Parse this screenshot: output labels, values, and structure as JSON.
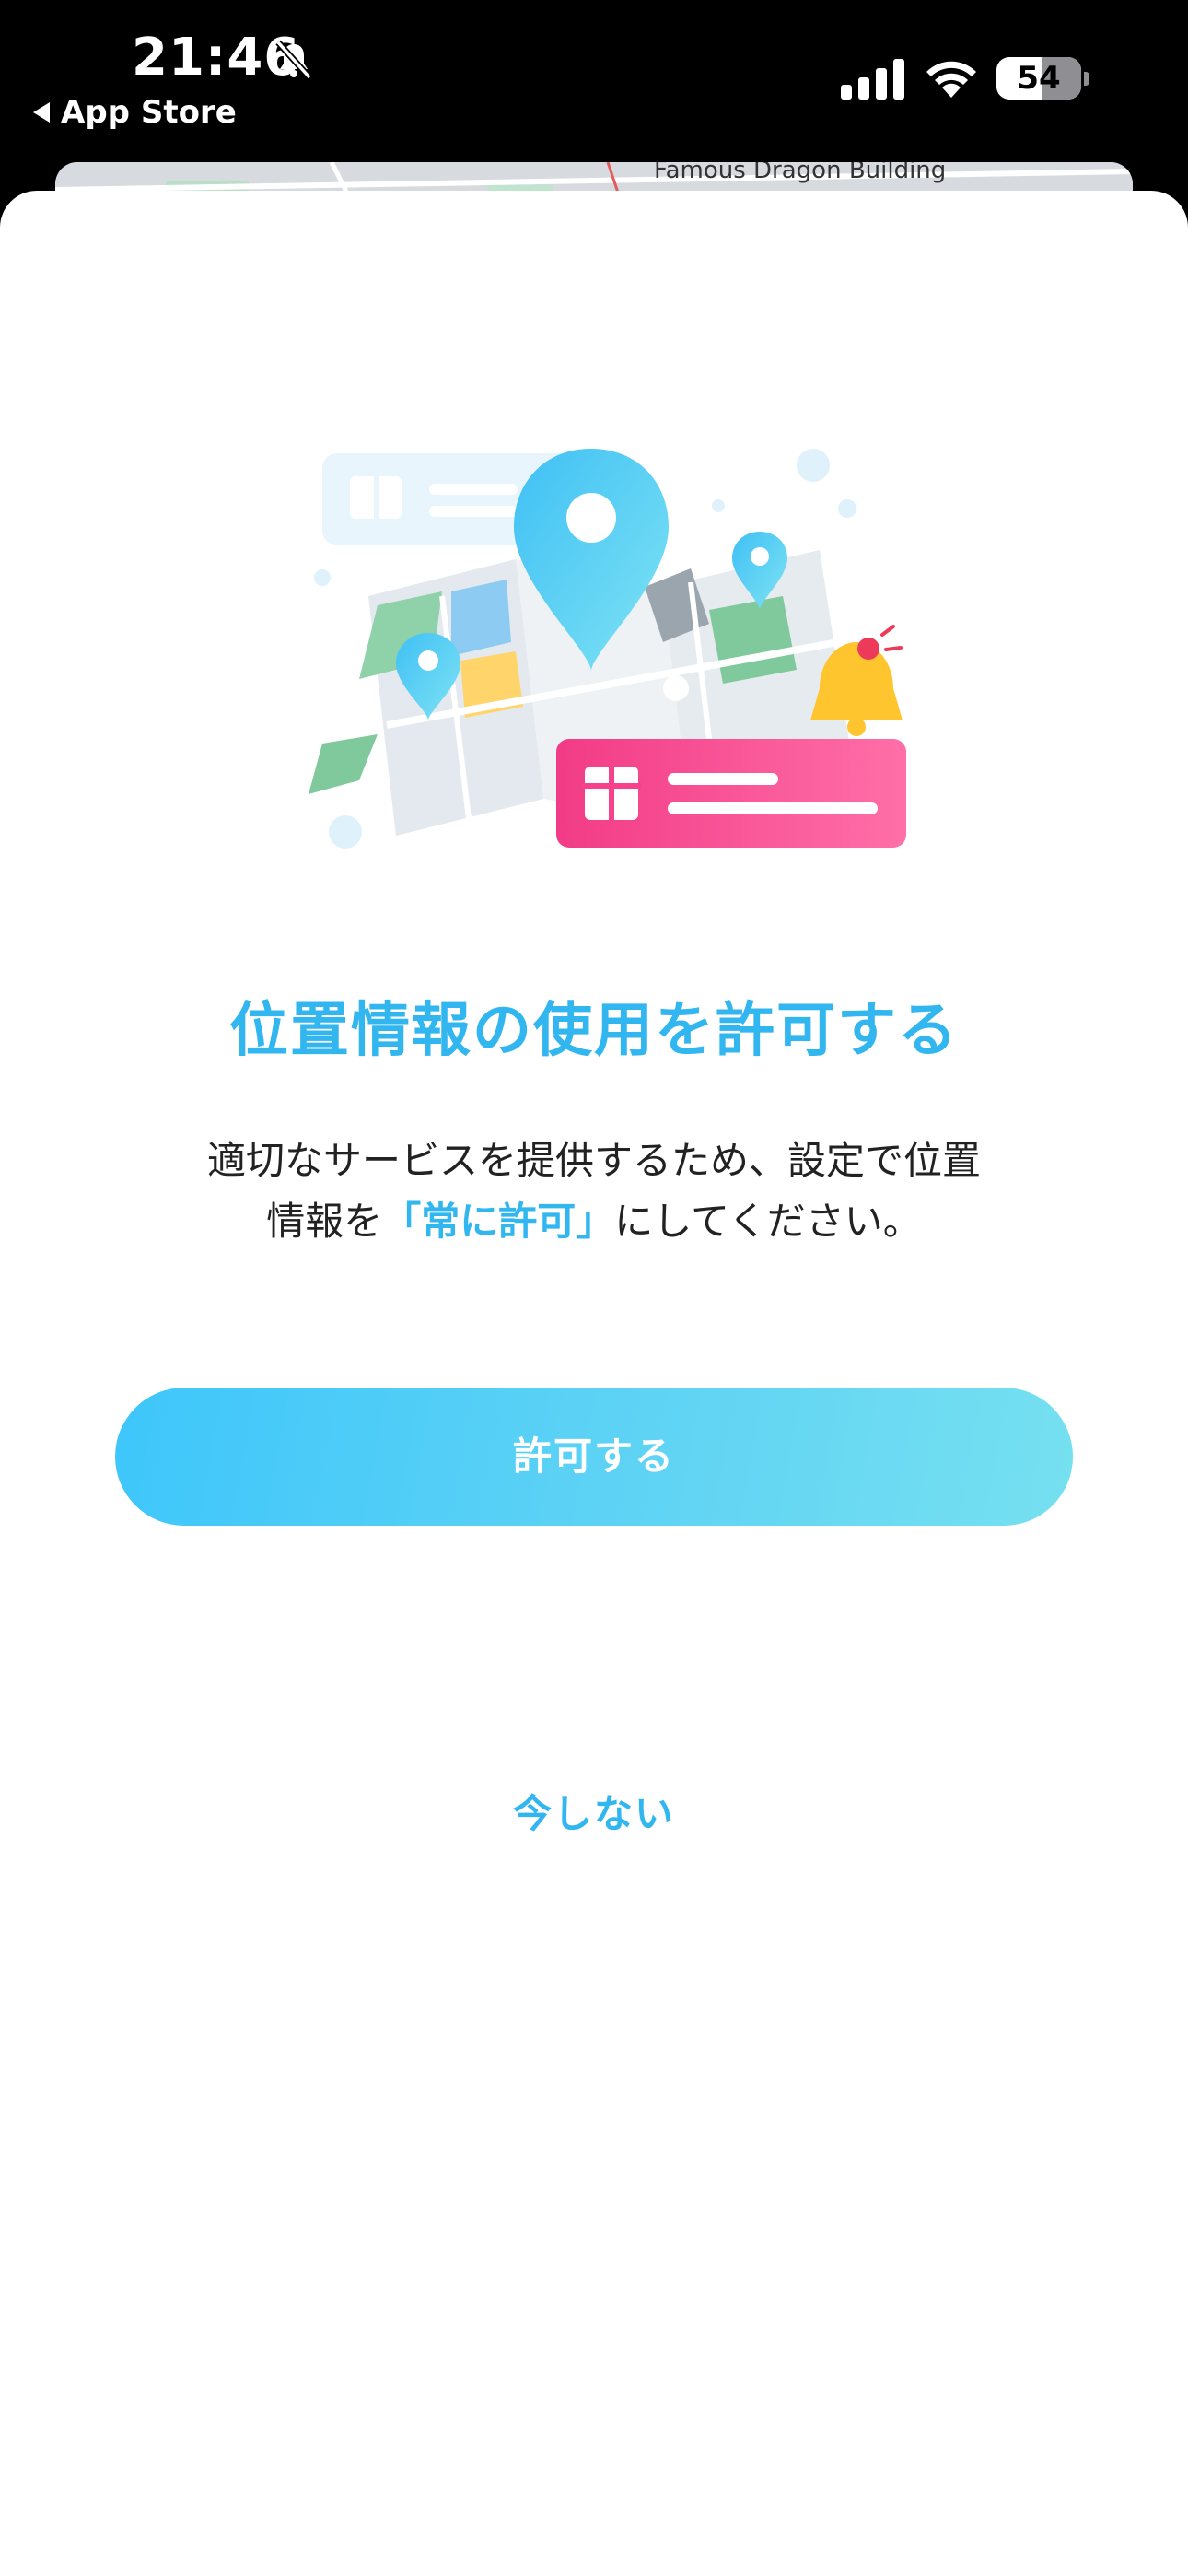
{
  "status_bar": {
    "time": "21:46",
    "back_label": "App Store",
    "battery_percent": "54",
    "battery_level": 0.54
  },
  "background": {
    "map_label": "Famous Dragon Building"
  },
  "permission_sheet": {
    "title": "位置情報の使用を許可する",
    "description_line1": "適切なサービスを提供するため、設定で位置",
    "description_line2_prefix": "情報を",
    "description_highlight": "「常に許可」",
    "description_line2_suffix": "にしてください。",
    "allow_button_label": "許可する",
    "later_button_label": "今しない"
  },
  "colors": {
    "accent": "#32b6f0",
    "button_gradient_start": "#3ec6fb",
    "button_gradient_end": "#76e0f0",
    "coupon_pink": "#f7418c",
    "bell_yellow": "#ffc52e"
  },
  "icons": {
    "mute": "bell-slash-icon",
    "signal": "cellular-signal-icon",
    "wifi": "wifi-icon",
    "hero": "map-pins-gift-illustration"
  }
}
